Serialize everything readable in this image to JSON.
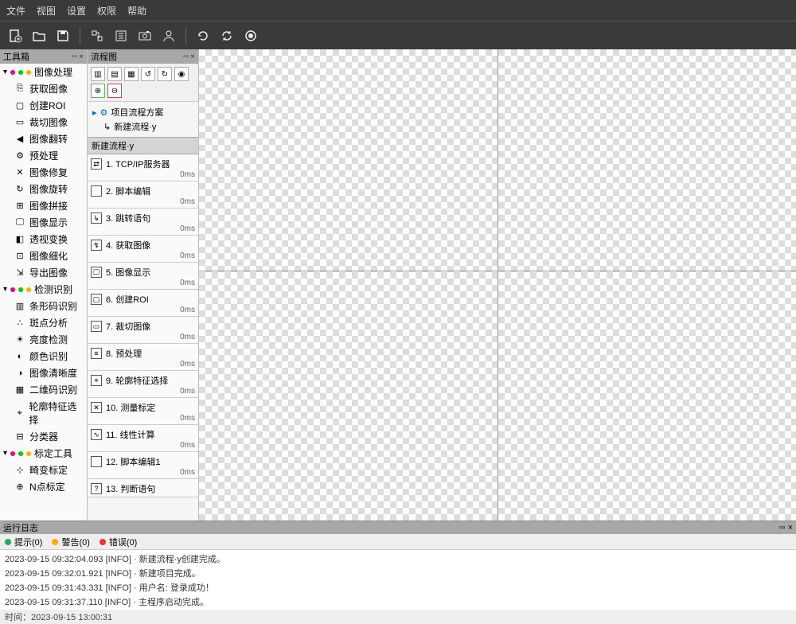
{
  "menu": [
    "文件",
    "视图",
    "设置",
    "权限",
    "帮助"
  ],
  "toolbox": {
    "title": "工具箱",
    "groups": [
      {
        "label": "图像处理",
        "dots": [
          "#e07",
          "#0c0",
          "#fa0"
        ],
        "items": [
          {
            "icon": "⎘",
            "label": "获取图像"
          },
          {
            "icon": "▢",
            "label": "创建ROI"
          },
          {
            "icon": "▭",
            "label": "裁切图像"
          },
          {
            "icon": "◀",
            "label": "图像翻转"
          },
          {
            "icon": "⚙",
            "label": "预处理"
          },
          {
            "icon": "✕",
            "label": "图像修复"
          },
          {
            "icon": "↻",
            "label": "图像旋转"
          },
          {
            "icon": "⊞",
            "label": "图像拼接"
          },
          {
            "icon": "🖵",
            "label": "图像显示"
          },
          {
            "icon": "◧",
            "label": "透视变换"
          },
          {
            "icon": "⊡",
            "label": "图像细化"
          },
          {
            "icon": "⇲",
            "label": "导出图像"
          }
        ]
      },
      {
        "label": "检测识别",
        "dots": [
          "#e07",
          "#0c0",
          "#fa0"
        ],
        "items": [
          {
            "icon": "▥",
            "label": "条形码识别"
          },
          {
            "icon": "∴",
            "label": "斑点分析"
          },
          {
            "icon": "☀",
            "label": "亮度检测"
          },
          {
            "icon": "◐",
            "label": "颜色识别"
          },
          {
            "icon": "◑",
            "label": "图像清晰度"
          },
          {
            "icon": "▦",
            "label": "二维码识别"
          },
          {
            "icon": "⌖",
            "label": "轮廓特征选择"
          },
          {
            "icon": "⊟",
            "label": "分类器"
          }
        ]
      },
      {
        "label": "标定工具",
        "dots": [
          "#e07",
          "#0c0",
          "#fa0"
        ],
        "items": [
          {
            "icon": "⊹",
            "label": "畸变标定"
          },
          {
            "icon": "⊕",
            "label": "N点标定"
          }
        ]
      }
    ]
  },
  "flow": {
    "title": "流程图",
    "tree_root": "项目流程方案",
    "tree_child": "新建流程·y",
    "subtitle": "新建流程·y",
    "steps": [
      {
        "ic": "⇄",
        "label": "1. TCP/IP服务器",
        "time": "0ms"
      },
      {
        "ic": "</>",
        "label": "2. 脚本编辑",
        "time": "0ms"
      },
      {
        "ic": "↳",
        "label": "3. 跳转语句",
        "time": "0ms"
      },
      {
        "ic": "↯",
        "label": "4. 获取图像",
        "time": "0ms"
      },
      {
        "ic": "🖵",
        "label": "5. 图像显示",
        "time": "0ms"
      },
      {
        "ic": "▢",
        "label": "6. 创建ROI",
        "time": "0ms"
      },
      {
        "ic": "▭",
        "label": "7. 裁切图像",
        "time": "0ms"
      },
      {
        "ic": "≡",
        "label": "8. 预处理",
        "time": "0ms"
      },
      {
        "ic": "⌖",
        "label": "9. 轮廓特征选择",
        "time": "0ms"
      },
      {
        "ic": "✕",
        "label": "10. 测量标定",
        "time": "0ms"
      },
      {
        "ic": "∿",
        "label": "11. 线性计算",
        "time": "0ms"
      },
      {
        "ic": "</>",
        "label": "12. 脚本编辑1",
        "time": "0ms"
      },
      {
        "ic": "?",
        "label": "13. 判断语句",
        "time": ""
      }
    ]
  },
  "log": {
    "title": "运行日志",
    "tabs": [
      {
        "color": "#2a6",
        "label": "提示(0)"
      },
      {
        "color": "#fa0",
        "label": "警告(0)"
      },
      {
        "color": "#e33",
        "label": "错误(0)"
      }
    ],
    "rows": [
      "2023-09-15 09:32:04.093 [INFO] · 新建流程·y创建完成。",
      "2023-09-15 09:32:01.921 [INFO] · 新建项目完成。",
      "2023-09-15 09:31:43.331 [INFO] · 用户名: 登录成功！",
      "2023-09-15 09:31:37.110 [INFO] · 主程序启动完成。"
    ]
  },
  "status": "时间：2023-09-15 13:00:31"
}
